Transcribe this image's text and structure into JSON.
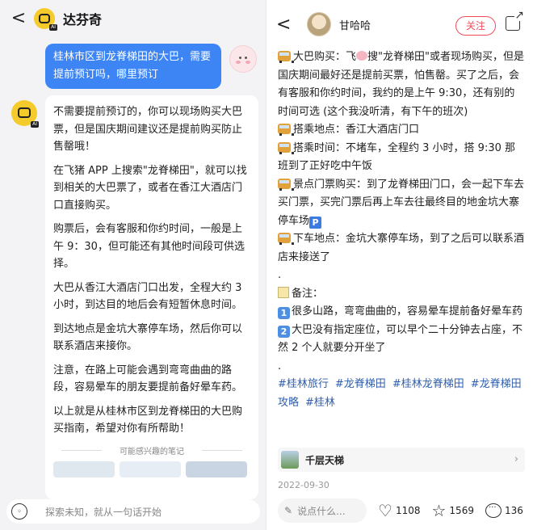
{
  "left": {
    "header": {
      "title": "达芬奇",
      "back_glyph": "<",
      "ai_badge": "AI"
    },
    "user_message": "桂林市区到龙脊梯田的大巴，需要提前预订吗，哪里预订",
    "bot_paragraphs": [
      "不需要提前预订的，你可以现场购买大巴票，但是国庆期间建议还是提前购买防止售罄哦！",
      "在飞猪 APP 上搜索\"龙脊梯田\"，就可以找到相关的大巴票了，或者在香江大酒店门口直接购买。",
      "购票后，会有客服和你约时间，一般是上午 9：30，但可能还有其他时间段可供选择。",
      "大巴从香江大酒店门口出发，全程大约 3 小时，到达目的地后会有短暂休息时间。",
      "到达地点是金坑大寨停车场，然后你可以联系酒店来接你。",
      "注意，在路上可能会遇到弯弯曲曲的路段，容易晕车的朋友要提前备好晕车药。",
      "以上就是从桂林市区到龙脊梯田的大巴购买指南，希望对你有所帮助！"
    ],
    "notes_label": "可能感兴趣的笔记",
    "input_placeholder": "探索未知，就从一句话开始"
  },
  "right": {
    "header": {
      "author": "甘哈哈",
      "follow_label": "关注",
      "back_glyph": "<"
    },
    "post": {
      "buy_label": "大巴购买：",
      "buy_a": "飞",
      "buy_b": "搜\"龙脊梯田\"或者现场购买，但是国庆期间最好还是提前买票，怕售罄。买了之后，会有客服和你约时间，我约的是上午 9:30，还有别的时间可选 (这个我没听清，有下午的班次)",
      "pickup_label": "搭乘地点：",
      "pickup": "香江大酒店门口",
      "time_label": "搭乘时间：",
      "time": "不堵车，全程约 3 小时，搭 9:30 那班到了正好吃中午饭",
      "ticket_label": "景点门票购买：",
      "ticket": "到了龙脊梯田门口，会一起下车去买门票，买完门票后再上车去往最终目的地金坑大寨停车场",
      "parking_glyph": "P",
      "dropoff_label": "下车地点：",
      "dropoff": "金坑大寨停车场，到了之后可以联系酒店来接送了",
      "dot1": ".",
      "remark_label": "备注：",
      "n1": "1",
      "remark1": "很多山路，弯弯曲曲的，容易晕车提前备好晕车药",
      "n2": "2",
      "remark2": "大巴没有指定座位，可以早个二十分钟去占座，不然 2 个人就要分开坐了",
      "dot2": ".",
      "tags": [
        "#桂林旅行",
        "#龙脊梯田",
        "#桂林龙脊梯田",
        "#龙脊梯田攻略",
        "#桂林"
      ]
    },
    "related_title": "千层天梯",
    "date": "2022-09-30",
    "comment_placeholder": "说点什么...",
    "likes": "1108",
    "stars": "1569",
    "comments": "136"
  }
}
